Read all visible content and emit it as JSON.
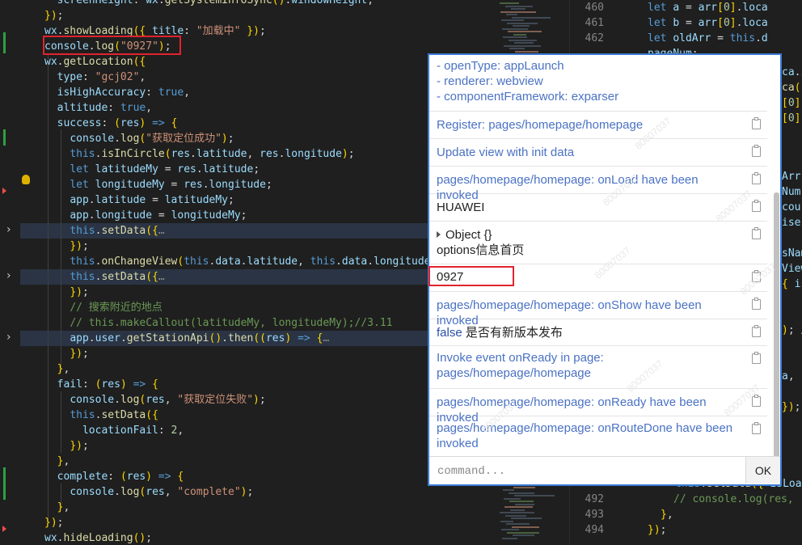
{
  "editor_left": {
    "lines": [
      "    screenHeight: wx.getSystemInfoSync().windowHeight,",
      "  });",
      "  wx.showLoading({ title: \"加载中\" });",
      "  console.log(\"0927\");",
      "  wx.getLocation({",
      "    type: \"gcj02\",",
      "    isHighAccuracy: true,",
      "    altitude: true,",
      "    success: (res) => {",
      "      console.log(\"获取定位成功\");",
      "      this.isInCircle(res.latitude, res.longitude);",
      "      let latitudeMy = res.latitude;",
      "      let longitudeMy = res.longitude;",
      "      app.latitude = latitudeMy;",
      "      app.longitude = longitudeMy;",
      "      this.setData({…",
      "      });",
      "      this.onChangeView(this.data.latitude, this.data.longitude)",
      "      this.setData({…",
      "      });",
      "      // 搜索附近的地点",
      "      // this.makeCallout(latitudeMy, longitudeMy);//3.11",
      "      app.user.getStationApi().then((res) => {…",
      "      });",
      "    },",
      "    fail: (res) => {",
      "      console.log(res, \"获取定位失败\");",
      "      this.setData({",
      "        locationFail: 2,",
      "      });",
      "    },",
      "    complete: (res) => {",
      "      console.log(res, \"complete\");",
      "    },",
      "  });",
      "  wx.hideLoading();"
    ]
  },
  "editor_right": {
    "line_numbers_top": [
      "460",
      "461",
      "462"
    ],
    "line_numbers_bottom": [
      "492",
      "493",
      "494"
    ],
    "code_top": [
      "      let a = arr[0].loca",
      "      let b = arr[0].loca",
      "      let oldArr = this.d",
      "      pageNum: "
    ],
    "code_fragments": [
      "ca.i",
      "ca(",
      "[0].",
      "[0].",
      "Arr,",
      "Num,",
      "cou",
      "ise,",
      "sNam",
      "View",
      "{ is",
      "); /",
      "a,",
      "});"
    ],
    "code_bottom": [
      "      this.setData({ isLoad",
      "      // console.log(res, '",
      "    },",
      "  });"
    ]
  },
  "console": {
    "rows": [
      {
        "lines": [
          "- openType: appLaunch",
          "- renderer: webview",
          "- componentFramework: exparser"
        ],
        "style": "blue"
      },
      {
        "lines": [
          "Register: pages/homepage/homepage"
        ],
        "style": "blue"
      },
      {
        "lines": [
          "Update view with init data"
        ],
        "style": "blue"
      },
      {
        "lines": [
          "pages/homepage/homepage: onLoad have been invoked"
        ],
        "style": "blue"
      },
      {
        "lines": [
          "HUAWEI"
        ],
        "style": "dark"
      },
      {
        "lines": [
          "Object {}",
          "options信息首页"
        ],
        "style": "dark"
      },
      {
        "lines": [
          "0927"
        ],
        "style": "dark"
      },
      {
        "lines": [
          "pages/homepage/homepage: onShow have been invoked"
        ],
        "style": "blue"
      },
      {
        "keyword": "false",
        "lines": [
          " 是否有新版本发布"
        ],
        "style": "dark"
      },
      {
        "lines": [
          "Invoke event onReady in page:",
          "pages/homepage/homepage"
        ],
        "style": "blue"
      },
      {
        "lines": [
          "pages/homepage/homepage: onReady have been invoked"
        ],
        "style": "blue"
      },
      {
        "lines": [
          "pages/homepage/homepage: onRouteDone have been",
          "invoked"
        ],
        "style": "blue"
      }
    ],
    "watermark": "80007037",
    "command_placeholder": "command...",
    "ok_label": "OK"
  },
  "colors": {
    "highlight_box": "#e0232e",
    "console_border": "#3a7bd5",
    "log_blue": "#4a72c4"
  }
}
